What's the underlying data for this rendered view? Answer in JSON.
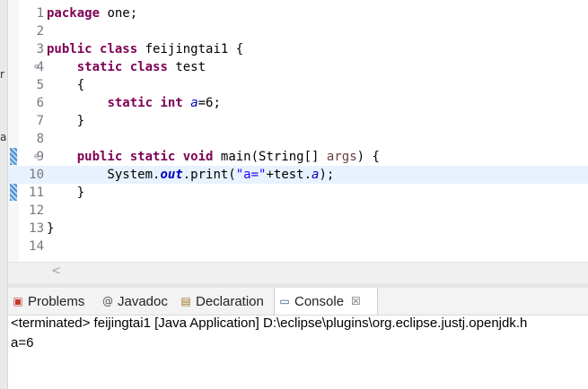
{
  "left_strip_glyphs": [
    "r",
    "a"
  ],
  "editor": {
    "lines": [
      {
        "n": "1",
        "fold": "",
        "tokens": [
          {
            "t": "kw",
            "v": "package"
          },
          {
            "t": "",
            "v": " one;"
          }
        ]
      },
      {
        "n": "2",
        "fold": "",
        "tokens": []
      },
      {
        "n": "3",
        "fold": "",
        "tokens": [
          {
            "t": "kw",
            "v": "public"
          },
          {
            "t": "",
            "v": " "
          },
          {
            "t": "kw",
            "v": "class"
          },
          {
            "t": "",
            "v": " feijingtai1 {"
          }
        ]
      },
      {
        "n": "4",
        "fold": "⊖",
        "tokens": [
          {
            "t": "",
            "v": "    "
          },
          {
            "t": "kw",
            "v": "static"
          },
          {
            "t": "",
            "v": " "
          },
          {
            "t": "kw",
            "v": "class"
          },
          {
            "t": "",
            "v": " test"
          }
        ]
      },
      {
        "n": "5",
        "fold": "",
        "tokens": [
          {
            "t": "",
            "v": "    {"
          }
        ]
      },
      {
        "n": "6",
        "fold": "",
        "tokens": [
          {
            "t": "",
            "v": "        "
          },
          {
            "t": "kw",
            "v": "static"
          },
          {
            "t": "",
            "v": " "
          },
          {
            "t": "kw",
            "v": "int"
          },
          {
            "t": "",
            "v": " "
          },
          {
            "t": "fld",
            "v": "a"
          },
          {
            "t": "",
            "v": "=6;"
          }
        ]
      },
      {
        "n": "7",
        "fold": "",
        "tokens": [
          {
            "t": "",
            "v": "    }"
          }
        ]
      },
      {
        "n": "8",
        "fold": "",
        "tokens": []
      },
      {
        "n": "9",
        "fold": "⊖",
        "tokens": [
          {
            "t": "",
            "v": "    "
          },
          {
            "t": "kw",
            "v": "public"
          },
          {
            "t": "",
            "v": " "
          },
          {
            "t": "kw",
            "v": "static"
          },
          {
            "t": "",
            "v": " "
          },
          {
            "t": "kw",
            "v": "void"
          },
          {
            "t": "",
            "v": " main(String[] "
          },
          {
            "t": "prm",
            "v": "args"
          },
          {
            "t": "",
            "v": ") {"
          }
        ]
      },
      {
        "n": "10",
        "fold": "",
        "tokens": [
          {
            "t": "",
            "v": "        System."
          },
          {
            "t": "stfld",
            "v": "out"
          },
          {
            "t": "",
            "v": ".print("
          },
          {
            "t": "str",
            "v": "\"a=\""
          },
          {
            "t": "",
            "v": "+test."
          },
          {
            "t": "fld",
            "v": "a"
          },
          {
            "t": "",
            "v": ");"
          }
        ]
      },
      {
        "n": "11",
        "fold": "",
        "tokens": [
          {
            "t": "",
            "v": "    }"
          }
        ]
      },
      {
        "n": "12",
        "fold": "",
        "tokens": []
      },
      {
        "n": "13",
        "fold": "",
        "tokens": [
          {
            "t": "",
            "v": "}"
          }
        ]
      },
      {
        "n": "14",
        "fold": "",
        "tokens": []
      }
    ],
    "current_line": "10",
    "scroll_left_arrow": "<"
  },
  "tabs": [
    {
      "label": "Problems",
      "icon": "problems-icon",
      "glyph": "▣",
      "color": "#c0392b"
    },
    {
      "label": "Javadoc",
      "icon": "javadoc-icon",
      "glyph": "@",
      "color": "#555555"
    },
    {
      "label": "Declaration",
      "icon": "declaration-icon",
      "glyph": "▤",
      "color": "#a0782a"
    },
    {
      "label": "Console",
      "icon": "console-icon",
      "glyph": "▭",
      "color": "#2b5a8a",
      "active": true,
      "close": "☒"
    }
  ],
  "console": {
    "status_line": "<terminated> feijingtai1 [Java Application] D:\\eclipse\\plugins\\org.eclipse.justj.openjdk.h",
    "output": "a=6"
  }
}
